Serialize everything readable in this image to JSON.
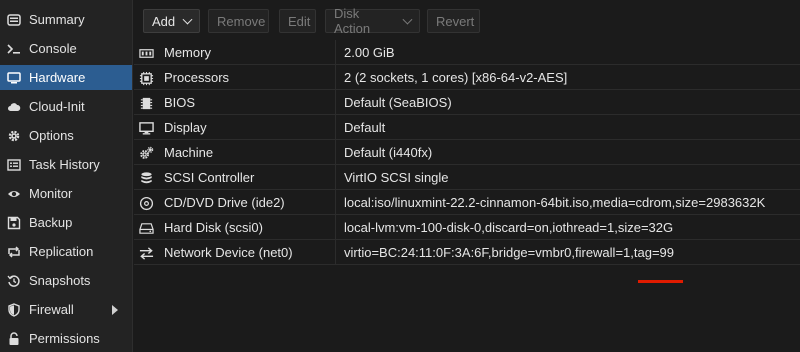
{
  "sidebar": {
    "items": [
      {
        "label": "Summary",
        "icon": "summary-icon"
      },
      {
        "label": "Console",
        "icon": "console-icon"
      },
      {
        "label": "Hardware",
        "icon": "hardware-icon",
        "active": true
      },
      {
        "label": "Cloud-Init",
        "icon": "cloud-icon"
      },
      {
        "label": "Options",
        "icon": "gear-icon"
      },
      {
        "label": "Task History",
        "icon": "task-list-icon"
      },
      {
        "label": "Monitor",
        "icon": "eye-icon"
      },
      {
        "label": "Backup",
        "icon": "floppy-icon"
      },
      {
        "label": "Replication",
        "icon": "retweet-icon"
      },
      {
        "label": "Snapshots",
        "icon": "history-icon"
      },
      {
        "label": "Firewall",
        "icon": "shield-icon",
        "has_submenu": true
      },
      {
        "label": "Permissions",
        "icon": "unlock-icon"
      }
    ]
  },
  "toolbar": {
    "add_label": "Add",
    "remove_label": "Remove",
    "edit_label": "Edit",
    "disk_action_label": "Disk Action",
    "revert_label": "Revert"
  },
  "hardware": {
    "rows": [
      {
        "name": "Memory",
        "value": "2.00 GiB",
        "icon": "memory-icon"
      },
      {
        "name": "Processors",
        "value": "2 (2 sockets, 1 cores) [x86-64-v2-AES]",
        "icon": "cpu-icon"
      },
      {
        "name": "BIOS",
        "value": "Default (SeaBIOS)",
        "icon": "microchip-icon"
      },
      {
        "name": "Display",
        "value": "Default",
        "icon": "desktop-icon"
      },
      {
        "name": "Machine",
        "value": "Default (i440fx)",
        "icon": "cogs-icon"
      },
      {
        "name": "SCSI Controller",
        "value": "VirtIO SCSI single",
        "icon": "database-icon"
      },
      {
        "name": "CD/DVD Drive (ide2)",
        "value": "local:iso/linuxmint-22.2-cinnamon-64bit.iso,media=cdrom,size=2983632K",
        "icon": "cdrom-icon"
      },
      {
        "name": "Hard Disk (scsi0)",
        "value": "local-lvm:vm-100-disk-0,discard=on,iothread=1,size=32G",
        "icon": "hdd-icon"
      },
      {
        "name": "Network Device (net0)",
        "value": "virtio=BC:24:11:0F:3A:6F,bridge=vmbr0,firewall=1,tag=99",
        "icon": "exchange-icon"
      }
    ]
  },
  "colors": {
    "accent": "#2c5d91",
    "highlight_underline": "#e01b00"
  }
}
